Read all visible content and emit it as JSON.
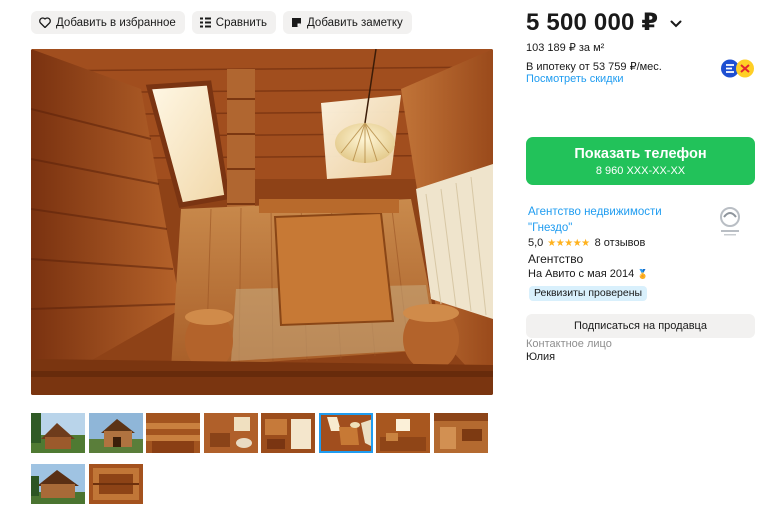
{
  "toolbar": {
    "favorite_label": "Добавить в избранное",
    "compare_label": "Сравнить",
    "note_label": "Добавить заметку"
  },
  "gallery": {
    "thumbnail_count": 10,
    "active_thumbnail_index": 5
  },
  "pricing": {
    "price": "5 500 000 ₽",
    "per_meter": "103 189 ₽ за м²",
    "mortgage": "В ипотеку от 53 759 ₽/мес.",
    "discounts_link": "Посмотреть скидки"
  },
  "contact": {
    "show_phone_label": "Показать телефон",
    "phone_masked": "8 960 XXX-XX-XX"
  },
  "seller": {
    "agency_name": "Агентство недвижимости \"Гнездо\"",
    "rating": "5,0",
    "stars": 5,
    "reviews": "8 отзывов",
    "type": "Агентство",
    "since": "На Авито с мая 2014",
    "verified_badge": "Реквизиты проверены",
    "subscribe_label": "Подписаться на продавца",
    "contact_person_label": "Контактное лицо",
    "contact_person": "Юлия"
  },
  "colors": {
    "accent_green": "#22c25a",
    "link_blue": "#1f9cf0",
    "star_yellow": "#ffb21e",
    "button_gray": "#f2f1f0"
  }
}
